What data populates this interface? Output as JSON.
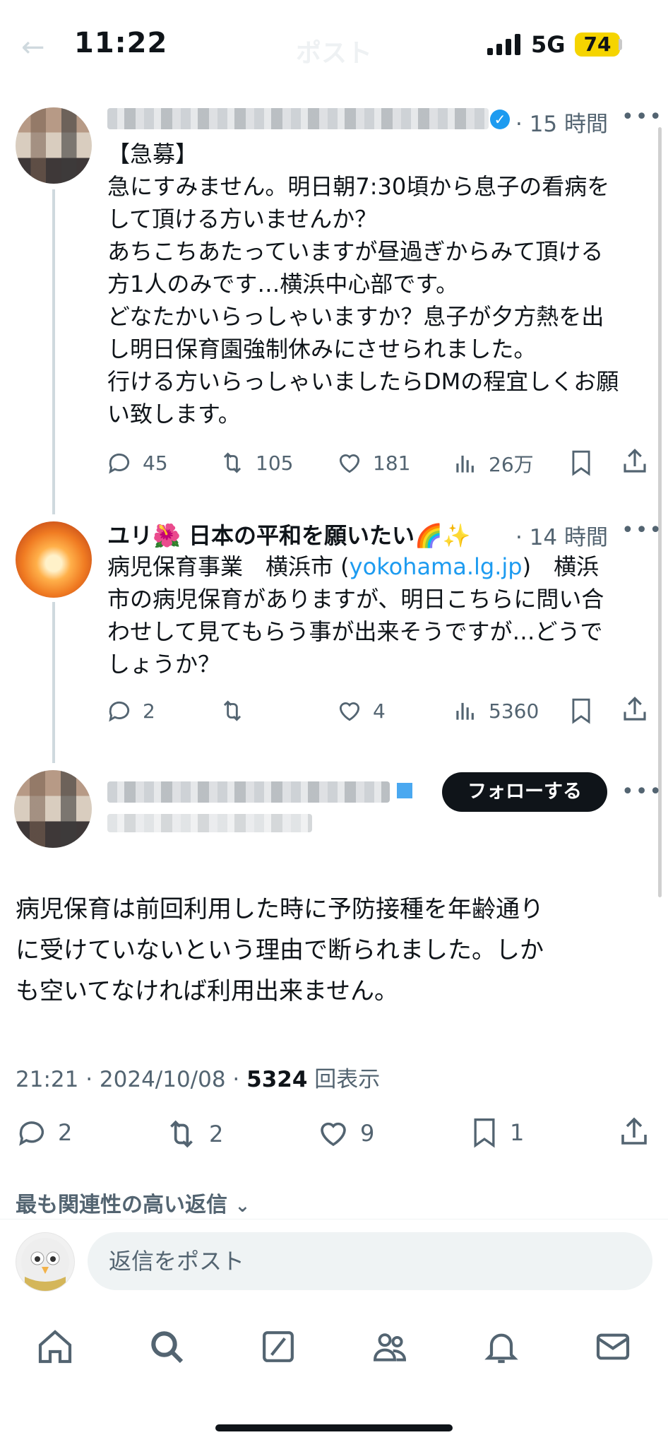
{
  "status_bar": {
    "time": "11:22",
    "network": "5G",
    "battery": "74"
  },
  "nav": {
    "title": "ポスト"
  },
  "reply1": {
    "time": "· 15 時間",
    "text": "【急募】\n急にすみません。明日朝7:30頃から息子の看病を\nして頂ける方いませんか？\nあちこちあたっていますが昼過ぎからみて頂ける\n方1人のみです…横浜中心部です。\nどなたかいらっしゃいますか？息子が夕方熱を出\nし明日保育園強制休みにさせられました。\n行ける方いらっしゃいましたらDMの程宜しくお願\nい致します。",
    "counts": {
      "reply": "45",
      "retweet": "105",
      "like": "181",
      "views": "26万"
    }
  },
  "reply2": {
    "name": "ユリ🌺 日本の平和を願いたい🌈✨",
    "time": "· 14 時間",
    "text_before": "病児保育事業　横浜市 (",
    "link": "yokohama.lg.jp",
    "text_after": ")　横浜\n市の病児保育がありますが、明日こちらに問い合\nわせして見てもらう事が出来そうですが…どうで\nしょうか？",
    "counts": {
      "reply": "2",
      "retweet": "",
      "like": "4",
      "views": "5360"
    }
  },
  "main_post": {
    "follow_label": "フォローする",
    "text": "病児保育は前回利用した時に予防接種を年齢通り\nに受けていないという理由で断られました。しか\nも空いてなければ利用出来ません。",
    "timestamp": "21:21 · 2024/10/08 · ",
    "views_count": "5324",
    "views_label": "回表示",
    "counts": {
      "reply": "2",
      "retweet": "2",
      "like": "9",
      "bookmark": "1"
    }
  },
  "replies_sort": {
    "label": "最も関連性の高い返信"
  },
  "composer": {
    "placeholder": "返信をポスト"
  },
  "tabbar": {
    "icons": [
      "home-icon",
      "search-icon",
      "grok-icon",
      "communities-icon",
      "notifications-icon",
      "messages-icon"
    ]
  }
}
